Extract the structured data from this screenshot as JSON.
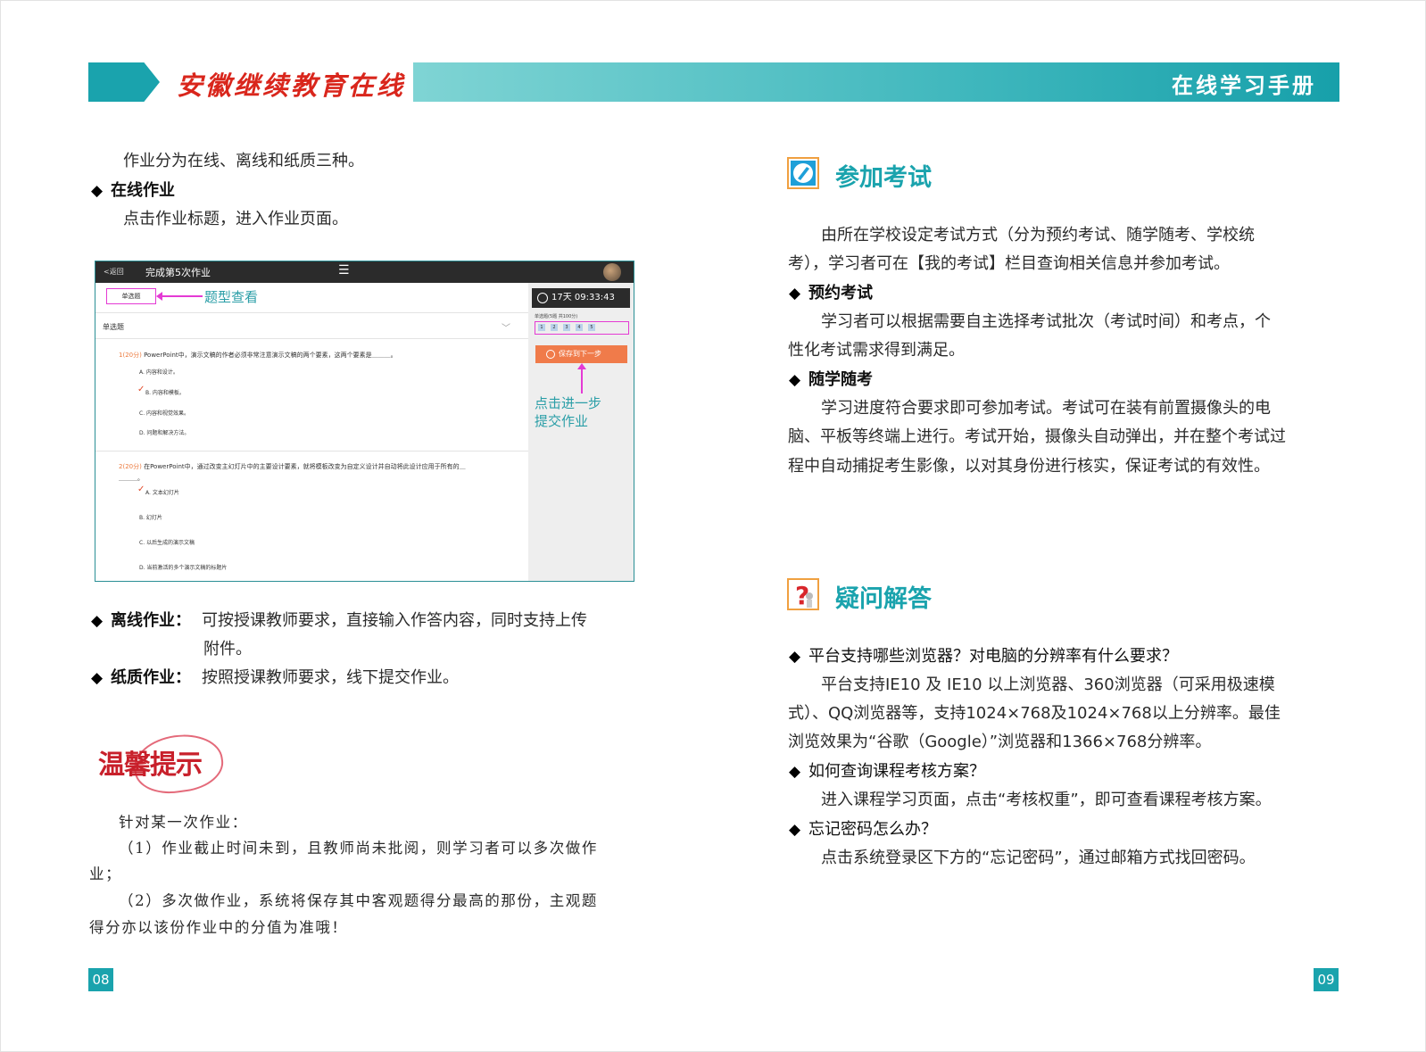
{
  "header": {
    "logo_text": "安徽继续教育在线",
    "manual_title": "在线学习手册"
  },
  "left": {
    "intro": "作业分为在线、离线和纸质三种。",
    "online_title": "在线作业",
    "online_desc": "点击作业标题，进入作业页面。",
    "offline_title": "离线作业：",
    "offline_desc_1": "可按授课教师要求，直接输入作答内容，同时支持上传",
    "offline_desc_2": "附件。",
    "paper_title": "纸质作业：",
    "paper_desc": "按照授课教师要求，线下提交作业。",
    "tip_title": "温馨提示",
    "tip_lines": [
      "针对某一次作业：",
      "（1）作业截止时间未到，且教师尚未批阅，则学习者可以多次做作",
      "业；",
      "（2）多次做作业，系统将保存其中客观题得分最高的那份，主观题",
      "得分亦以该份作业中的分值为准哦！"
    ],
    "page_number": "08"
  },
  "screenshot": {
    "back_label": "<返回",
    "title": "完成第5次作业",
    "menu_icon": "hamburger-icon",
    "timer": "17天 09:33:43",
    "question_type_tag": "单选题",
    "annotation_type": "题型查看",
    "section_label": "单选题",
    "progress_text": "单选题(5题 共100分)",
    "nums": [
      "1",
      "2",
      "3",
      "4",
      "5"
    ],
    "save_button": "保存到下一步",
    "annotation_submit_1": "点击进一步",
    "annotation_submit_2": "提交作业",
    "q1_num": "1",
    "q1_score": "(20分)",
    "q1_text": "PowerPoint中，演示文稿的作者必须非常注意演示文稿的两个要素，这两个要素是＿＿＿。",
    "q1_options": [
      "A. 内容和设计。",
      "B. 内容和模板。",
      "C. 内容和视觉效果。",
      "D. 问题和解决方法。"
    ],
    "q2_num": "2",
    "q2_score": "(20分)",
    "q2_text": "在PowerPoint中，通过改变主幻灯片中的主要设计要素，就将模板改变为自定义设计并自动将此设计应用于所有的＿",
    "q2_text_2": "＿＿＿。",
    "q2_options": [
      "A. 文本幻灯片",
      "B. 幻灯片",
      "C. 以后生成的演示文稿",
      "D. 当前激活的多个演示文稿的标题片"
    ]
  },
  "right": {
    "exam_title": "参加考试",
    "exam_desc_1": "由所在学校设定考试方式（分为预约考试、随学随考、学校统",
    "exam_desc_2": "考），学习者可在【我的考试】栏目查询相关信息并参加考试。",
    "reserve_title": "预约考试",
    "reserve_desc_1": "学习者可以根据需要自主选择考试批次（考试时间）和考点，个",
    "reserve_desc_2": "性化考试需求得到满足。",
    "anytime_title": "随学随考",
    "anytime_desc_1": "学习进度符合要求即可参加考试。考试可在装有前置摄像头的电",
    "anytime_desc_2": "脑、平板等终端上进行。考试开始，摄像头自动弹出，并在整个考试过",
    "anytime_desc_3": "程中自动捕捉考生影像，以对其身份进行核实，保证考试的有效性。",
    "faq_title": "疑问解答",
    "faq1_q": "平台支持哪些浏览器？对电脑的分辨率有什么要求？",
    "faq1_a_1": "平台支持IE10 及 IE10 以上浏览器、360浏览器（可采用极速模",
    "faq1_a_2": "式）、QQ浏览器等，支持1024×768及1024×768以上分辨率。最佳",
    "faq1_a_3": "浏览效果为“谷歌（Google）”浏览器和1366×768分辨率。",
    "faq2_q": "如何查询课程考核方案？",
    "faq2_a": "进入课程学习页面，点击“考核权重”，即可查看课程考核方案。",
    "faq3_q": "忘记密码怎么办？",
    "faq3_a": "点击系统登录区下方的“忘记密码”，通过邮箱方式找回密码。",
    "page_number": "09"
  },
  "colors": {
    "teal": "#1aa3ad",
    "logo_red": "#d9261c",
    "annotation_magenta": "#e43ad4",
    "save_orange": "#f07b4a"
  }
}
